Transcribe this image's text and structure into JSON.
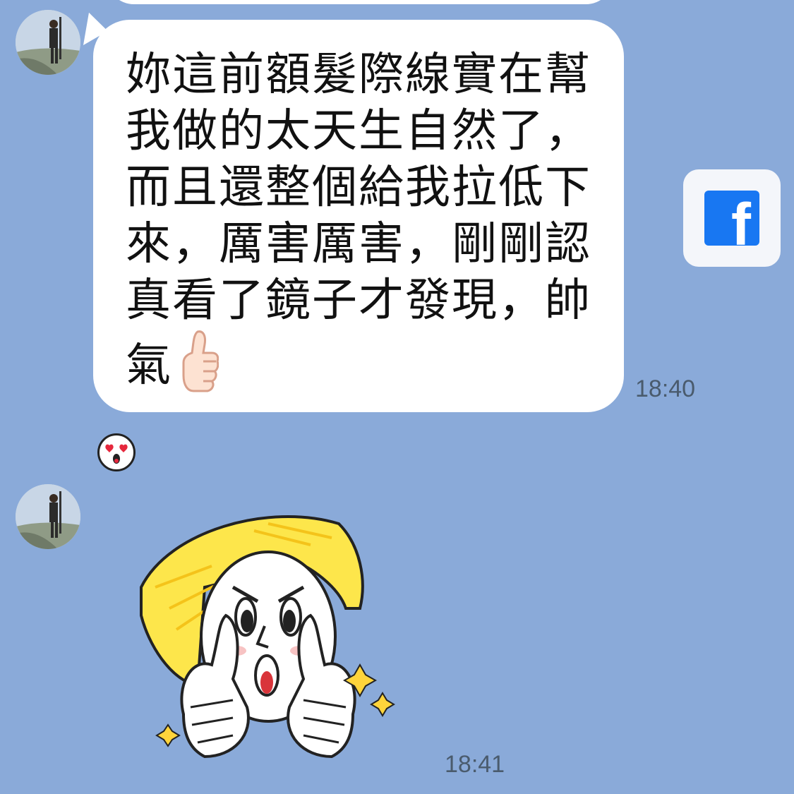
{
  "messages": [
    {
      "text": "妳這前額髮際線實在幫我做的太天生自然了，而且還整個給我拉低下來，厲害厲害，剛剛認真看了鏡子才發現，帥氣",
      "emoji": "thumbs-up",
      "time": "18:40",
      "reaction": "heart-eyes"
    },
    {
      "sticker": "blonde-character-double-thumbs-up",
      "time": "18:41"
    }
  ],
  "share": {
    "icon": "facebook-icon",
    "label": "f"
  },
  "colors": {
    "background": "#8aaad9",
    "bubble": "#ffffff",
    "facebook": "#1877f2",
    "hair": "#fde64b"
  }
}
